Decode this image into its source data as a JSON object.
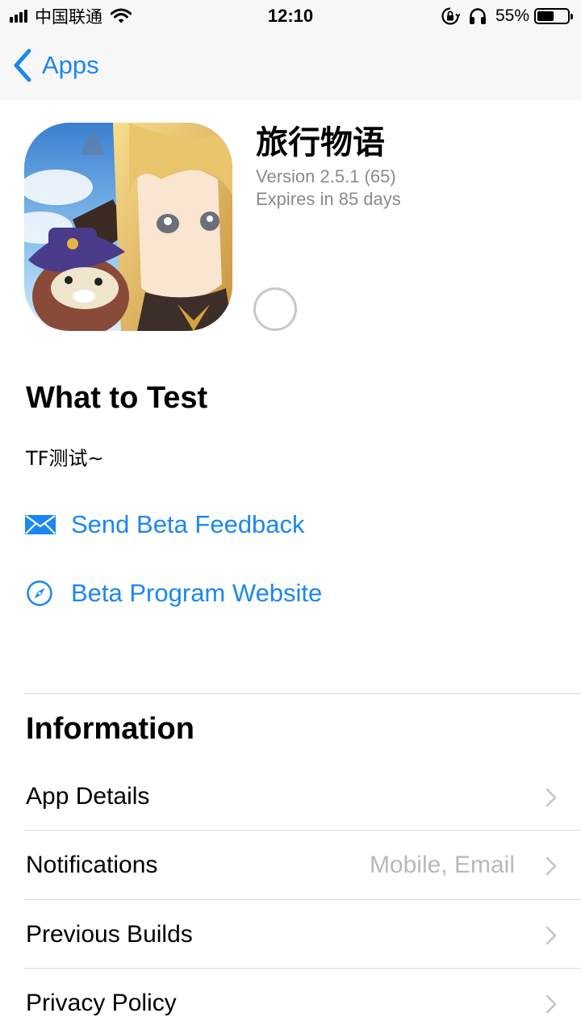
{
  "status_bar": {
    "carrier": "中国联通",
    "time": "12:10",
    "battery_percent": "55%",
    "battery_level": 0.55,
    "icons": [
      "signal-icon",
      "wifi-icon",
      "orientation-lock-icon",
      "headphones-icon",
      "battery-icon"
    ]
  },
  "nav": {
    "back_label": "Apps"
  },
  "app": {
    "name": "旅行物语",
    "version": "Version 2.5.1 (65)",
    "expires": "Expires in 85 days"
  },
  "what_to_test": {
    "title": "What to Test",
    "text": "TF测试~",
    "links": [
      {
        "label": "Send Beta Feedback",
        "icon": "mail-icon"
      },
      {
        "label": "Beta Program Website",
        "icon": "compass-icon"
      }
    ]
  },
  "information": {
    "title": "Information",
    "rows": [
      {
        "label": "App Details",
        "value": ""
      },
      {
        "label": "Notifications",
        "value": "Mobile, Email"
      },
      {
        "label": "Previous Builds",
        "value": ""
      },
      {
        "label": "Privacy Policy",
        "value": ""
      }
    ]
  },
  "colors": {
    "accent": "#1b87f2",
    "secondary_text": "#8a8a8f",
    "bar_background": "#f7f7f7"
  }
}
